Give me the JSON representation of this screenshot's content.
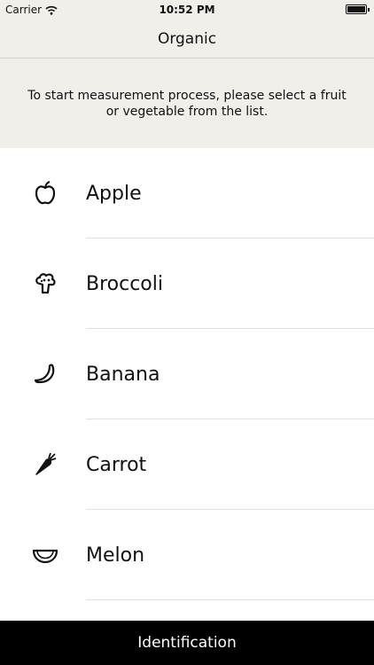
{
  "status_bar": {
    "carrier": "Carrier",
    "time": "10:52 PM"
  },
  "nav": {
    "title": "Organic"
  },
  "instructions": {
    "text": "To start measurement process, please select a fruit or vegetable from the list."
  },
  "items": [
    {
      "label": "Apple",
      "icon": "apple-icon"
    },
    {
      "label": "Broccoli",
      "icon": "broccoli-icon"
    },
    {
      "label": "Banana",
      "icon": "banana-icon"
    },
    {
      "label": "Carrot",
      "icon": "carrot-icon"
    },
    {
      "label": "Melon",
      "icon": "melon-icon"
    }
  ],
  "bottom": {
    "button_label": "Identification"
  }
}
